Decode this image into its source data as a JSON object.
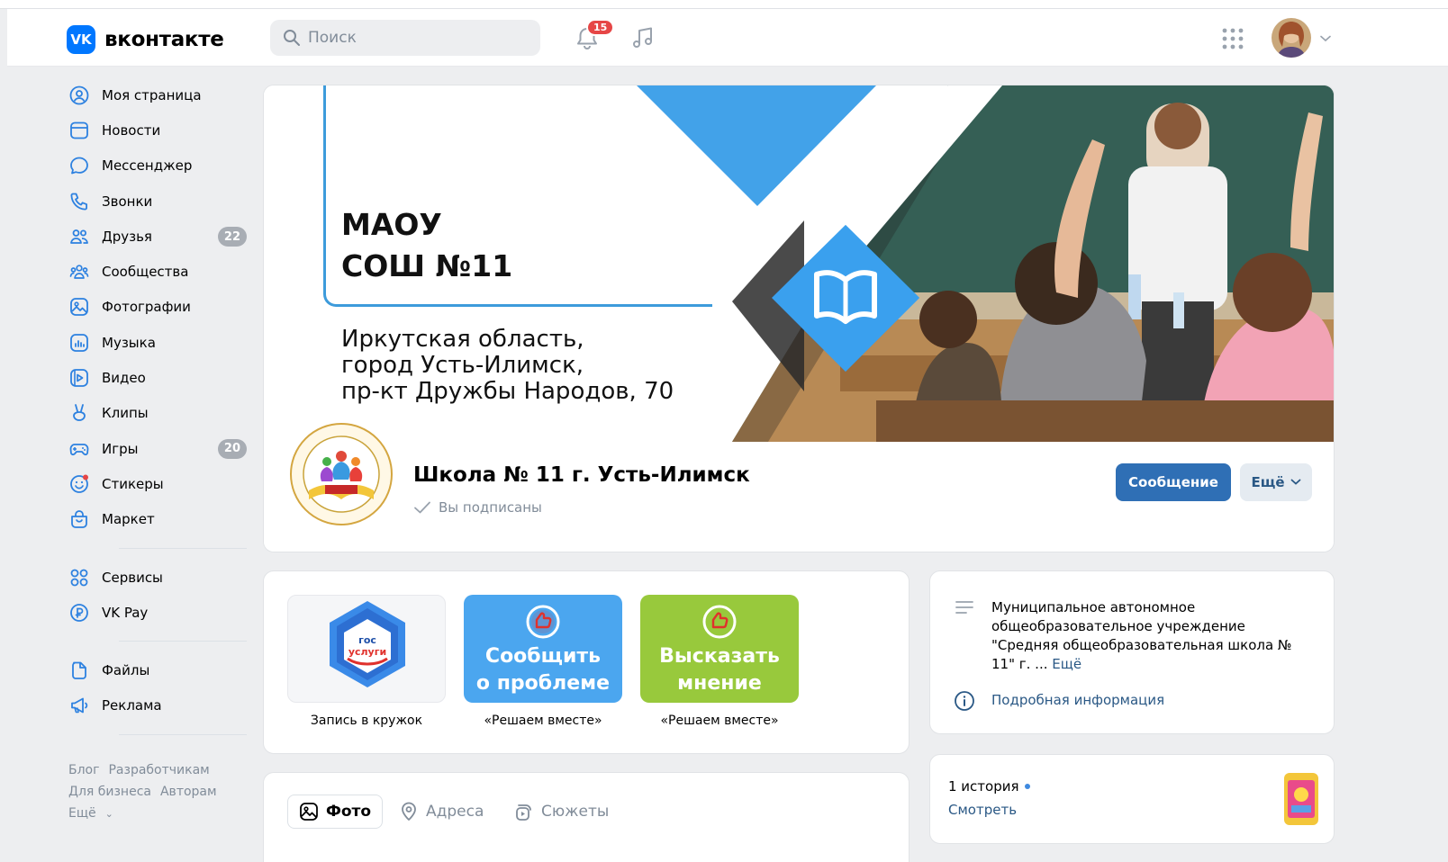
{
  "header": {
    "logo_mark": "VK",
    "logo_text": "вконтакте",
    "search_placeholder": "Поиск",
    "notifications_count": "15"
  },
  "sidebar": {
    "items": [
      {
        "label": "Моя страница",
        "icon": "user-circle-icon"
      },
      {
        "label": "Новости",
        "icon": "news-icon"
      },
      {
        "label": "Мессенджер",
        "icon": "message-icon"
      },
      {
        "label": "Звонки",
        "icon": "phone-icon"
      },
      {
        "label": "Друзья",
        "icon": "friends-icon",
        "badge": "22"
      },
      {
        "label": "Сообщества",
        "icon": "communities-icon"
      },
      {
        "label": "Фотографии",
        "icon": "photo-icon"
      },
      {
        "label": "Музыка",
        "icon": "music-icon"
      },
      {
        "label": "Видео",
        "icon": "video-icon"
      },
      {
        "label": "Клипы",
        "icon": "clips-icon"
      },
      {
        "label": "Игры",
        "icon": "games-icon",
        "badge": "20"
      },
      {
        "label": "Стикеры",
        "icon": "stickers-icon"
      },
      {
        "label": "Маркет",
        "icon": "market-icon"
      }
    ],
    "items2": [
      {
        "label": "Сервисы",
        "icon": "services-icon"
      },
      {
        "label": "VK Pay",
        "icon": "vkpay-icon"
      }
    ],
    "items3": [
      {
        "label": "Файлы",
        "icon": "files-icon"
      },
      {
        "label": "Реклама",
        "icon": "ads-icon"
      }
    ],
    "footer": {
      "blog": "Блог",
      "developers": "Разработчикам",
      "business": "Для бизнеса",
      "authors": "Авторам",
      "more": "Ещё"
    }
  },
  "cover": {
    "title_line1": "МАОУ",
    "title_line2": "СОШ №11",
    "address_line1": "Иркутская область,",
    "address_line2": "город Усть-Илимск,",
    "address_line3": "пр-кт Дружбы Народов, 70"
  },
  "profile": {
    "name": "Школа № 11 г. Усть-Илимск",
    "subscribed": "Вы подписаны",
    "message_button": "Сообщение",
    "more_button": "Ещё"
  },
  "widgets": [
    {
      "caption": "Запись в кружок",
      "color": "#f5f6f8"
    },
    {
      "line1": "Сообщить",
      "line2": "о проблеме",
      "caption": "«Решаем вместе»",
      "color": "#4ba6ef"
    },
    {
      "line1": "Высказать",
      "line2": "мнение",
      "caption": "«Решаем вместе»",
      "color": "#98c93c"
    }
  ],
  "info": {
    "description": "Муниципальное автономное общеобразовательное учреждение \"Средняя общеобразовательная школа № 11\" г. ...",
    "description_more": "Ещё",
    "details_link": "Подробная информация"
  },
  "story": {
    "count": "1 история",
    "watch": "Смотреть"
  },
  "tabs": [
    {
      "label": "Фото",
      "active": true
    },
    {
      "label": "Адреса",
      "active": false
    },
    {
      "label": "Сюжеты",
      "active": false
    }
  ],
  "colors": {
    "accent": "#2f6fb5",
    "link": "#2a5885",
    "brand": "#0077ff",
    "badge_red": "#e64646"
  }
}
